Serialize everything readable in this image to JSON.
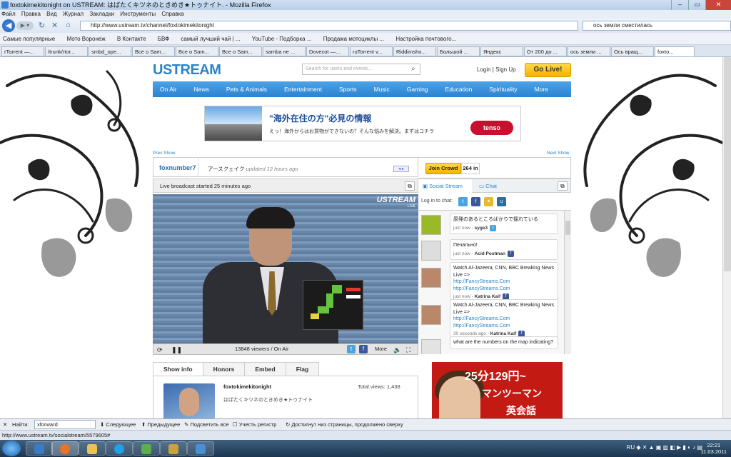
{
  "window": {
    "title": "foxtokimekitonight on USTREAM: はばたくキツネのときめき★トゥナイト. - Mozilla Firefox"
  },
  "menu": [
    "Файл",
    "Правка",
    "Вид",
    "Журнал",
    "Закладки",
    "Инструменты",
    "Справка"
  ],
  "nav": {
    "url": "http://www.ustream.tv/channel/foxtokimekitonight",
    "search_value": "ось земли сместилась"
  },
  "bookmarks": [
    "Самые популярные",
    "Мото Воронеж",
    "В Контакте",
    "БВФ",
    "самый лучший чай | ...",
    "YouTube - Подборка ...",
    "Продажа мотоциклы ...",
    "Настройка почтового..."
  ],
  "tabs": [
    "rTorrent —...",
    "/trunk/rtor...",
    "smbd_ope...",
    "Все о Sam...",
    "Все о Sam...",
    "Все о Sam...",
    "samba не ...",
    "Dovecot —...",
    "ruTorrent v...",
    "Riddimsho...",
    "Большой ...",
    "Яндекс",
    "От 200 до ...",
    "ось земли ...",
    "Ось вращ...",
    "foxto..."
  ],
  "site": {
    "logo": "USTREAM",
    "search_placeholder": "Search for users and events...",
    "login": "Login | Sign Up",
    "golive": "Go Live!",
    "menu": [
      "On Air",
      "News",
      "Pets & Animals",
      "Entertainment",
      "Sports",
      "Music",
      "Gaming",
      "Education",
      "Spirituality",
      "More"
    ]
  },
  "ad": {
    "title": "\"海外在住の方\"必見の情報",
    "sub": "えっ！海外からはお買物ができないの？そんな悩みを解決。まずはコチラ",
    "logo": "tenso"
  },
  "prev_show": "Prev Show",
  "next_show": "Next Show",
  "player": {
    "username": "foxnumber7",
    "title": "アースクェイク",
    "updated": "updated 12 hours ago",
    "live_started": "Live broadcast started 25 minutes ago",
    "video_logo": "USTREAM",
    "video_live": "LIVE",
    "viewers": "13848 viewers / On Air",
    "more": "More"
  },
  "show_tabs": [
    "Show info",
    "Honors",
    "Embed",
    "Flag"
  ],
  "show_info": {
    "name": "foxtokimekitonight",
    "desc": "はばたくキツネのときめき★トゥナイト",
    "views": "Total views: 1,438"
  },
  "crowd": {
    "join": "Join Crowd",
    "count": "264 in"
  },
  "social": {
    "tab1": "Social Stream",
    "tab2": "Chat",
    "login_label": "Log in to chat:"
  },
  "messages": [
    {
      "text": "原発のあるところばかりで揺れている",
      "time": "just now",
      "user": "syge3",
      "src": "t"
    },
    {
      "text": "Печально!",
      "time": "just now",
      "user": "Acid Postman",
      "src": "f"
    },
    {
      "text": "Watch Al-Jazeera, CNN, BBC Breaking News Live =>",
      "link1": "http://FancyStreams.Com",
      "link2": "http://FancyStreams.Com",
      "time": "just now",
      "user": "Katrina Kaif",
      "src": "f"
    },
    {
      "text": "Watch Al-Jazeera, CNN, BBC Breaking News Live =>",
      "link1": "http://FancyStreams.Com",
      "link2": "http://FancyStreams.Com",
      "time": "30 seconds ago",
      "user": "Katrina Kaif",
      "src": "f"
    },
    {
      "text": "what are the numbers on the map indicating?"
    }
  ],
  "side_ad": {
    "l1": "25分129円~",
    "l2": "マンツーマン",
    "l3": "英会話"
  },
  "findbar": {
    "label": "Найти:",
    "value": "xforward",
    "next": "Следующее",
    "prev": "Предыдущее",
    "highlight": "Подсветить все",
    "case": "Учесть регистр",
    "status": "Достигнут низ страницы, продолжено сверху"
  },
  "status": "http://www.ustream.tv/socialstream/5579605#",
  "taskbar": {
    "lang": "RU",
    "time": "22:21",
    "date": "11.03.2011"
  }
}
